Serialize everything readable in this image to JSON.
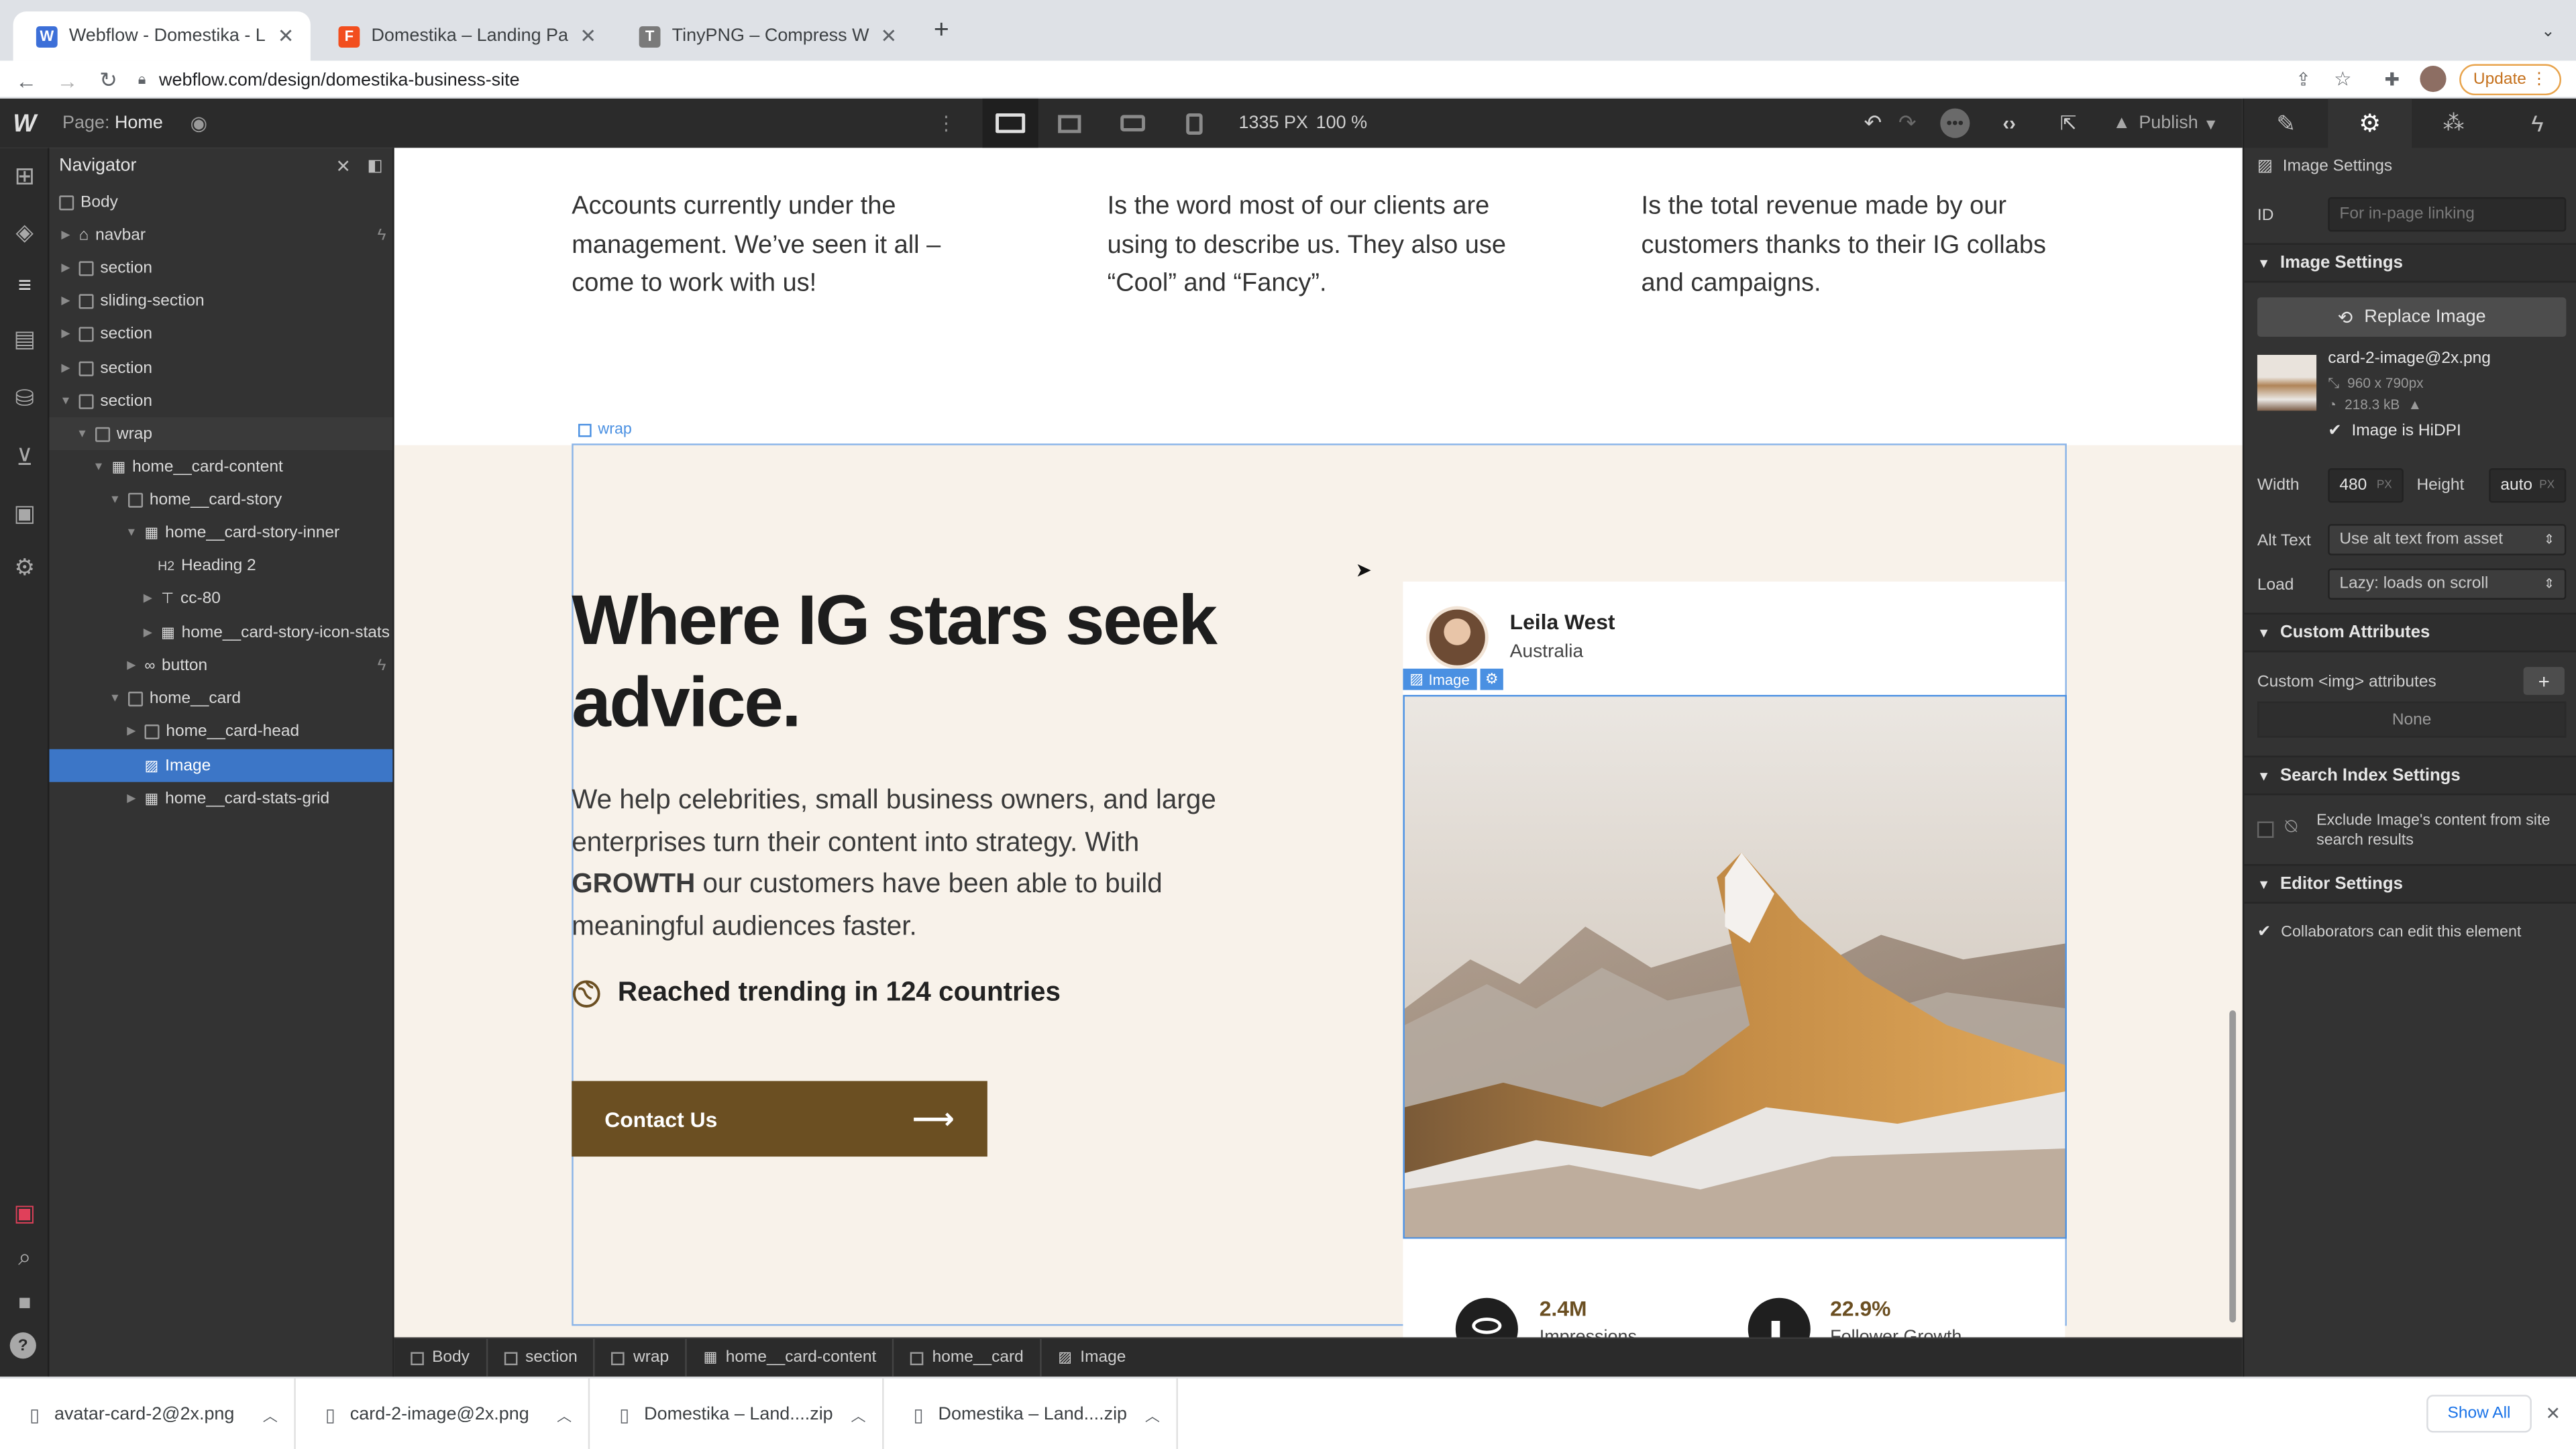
{
  "browser": {
    "tabs": [
      {
        "title": "Webflow - Domestika - Landin",
        "favicon": "W"
      },
      {
        "title": "Domestika – Landing Page – Fi",
        "favicon": "F"
      },
      {
        "title": "TinyPNG – Compress WebP, P",
        "favicon": "T"
      }
    ],
    "url": "webflow.com/design/domestika-business-site",
    "update_label": "Update"
  },
  "wf_topbar": {
    "page_label": "Page:",
    "page_name": "Home",
    "canvas_width": "1335 PX",
    "zoom": "100 %",
    "publish_label": "Publish"
  },
  "navigator": {
    "title": "Navigator",
    "items": [
      {
        "label": "Body"
      },
      {
        "label": "navbar"
      },
      {
        "label": "section"
      },
      {
        "label": "sliding-section"
      },
      {
        "label": "section"
      },
      {
        "label": "section"
      },
      {
        "label": "section"
      },
      {
        "label": "wrap"
      },
      {
        "label": "home__card-content"
      },
      {
        "label": "home__card-story"
      },
      {
        "label": "home__card-story-inner"
      },
      {
        "label": "Heading 2"
      },
      {
        "label": "cc-80"
      },
      {
        "label": "home__card-story-icon-stats"
      },
      {
        "label": "button"
      },
      {
        "label": "home__card"
      },
      {
        "label": "home__card-head"
      },
      {
        "label": "Image"
      },
      {
        "label": "home__card-stats-grid"
      }
    ]
  },
  "canvas": {
    "stats_text": [
      "Accounts currently under the management. We’ve seen it all – come to work with us!",
      "Is the word most of our clients are using to describe us. They also use “Cool” and “Fancy”.",
      "Is the total revenue made by our customers thanks to their IG collabs and campaigns."
    ],
    "wrap_label": "wrap",
    "heading": "Where IG stars seek advice.",
    "para_before": "We help celebrities, small business owners, and large enterprises turn their content into strategy. With ",
    "para_bold": "GROWTH",
    "para_after": " our customers have been able to build meaningful audiences faster.",
    "trending": "Reached trending in 124 countries",
    "contact_label": "Contact Us",
    "card": {
      "name": "Leila West",
      "location": "Australia",
      "image_badge": "Image",
      "stat1_value": "2.4M",
      "stat1_label": "Impressions",
      "stat2_value": "22.9%",
      "stat2_label": "Follower Growth"
    }
  },
  "breadcrumbs": [
    "Body",
    "section",
    "wrap",
    "home__card-content",
    "home__card",
    "Image"
  ],
  "right_panel": {
    "header": "Image Settings",
    "id_label": "ID",
    "id_placeholder": "For in-page linking",
    "section_image": "Image Settings",
    "replace_label": "Replace Image",
    "file_name": "card-2-image@2x.png",
    "file_dims": "960 x 790px",
    "file_size": "218.3 kB",
    "hidpi_label": "Image is HiDPI",
    "width_label": "Width",
    "width_value": "480",
    "width_unit": "PX",
    "height_label": "Height",
    "height_value": "auto",
    "height_unit": "PX",
    "alt_label": "Alt Text",
    "alt_value": "Use alt text from asset",
    "load_label": "Load",
    "load_value": "Lazy: loads on scroll",
    "section_custom": "Custom Attributes",
    "custom_label": "Custom <img> attributes",
    "custom_none": "None",
    "section_search": "Search Index Settings",
    "search_text": "Exclude Image's content from site search results",
    "section_editor": "Editor Settings",
    "editor_text": "Collaborators can edit this element"
  },
  "downloads": {
    "items": [
      "avatar-card-2@2x.png",
      "card-2-image@2x.png",
      "Domestika – Land....zip",
      "Domestika – Land....zip"
    ],
    "show_all": "Show All"
  },
  "colors": {
    "accent": "#4a90e2",
    "button_brown": "#6b4f22",
    "beige": "#f8f2ea",
    "logo_red": "#d6101d"
  }
}
